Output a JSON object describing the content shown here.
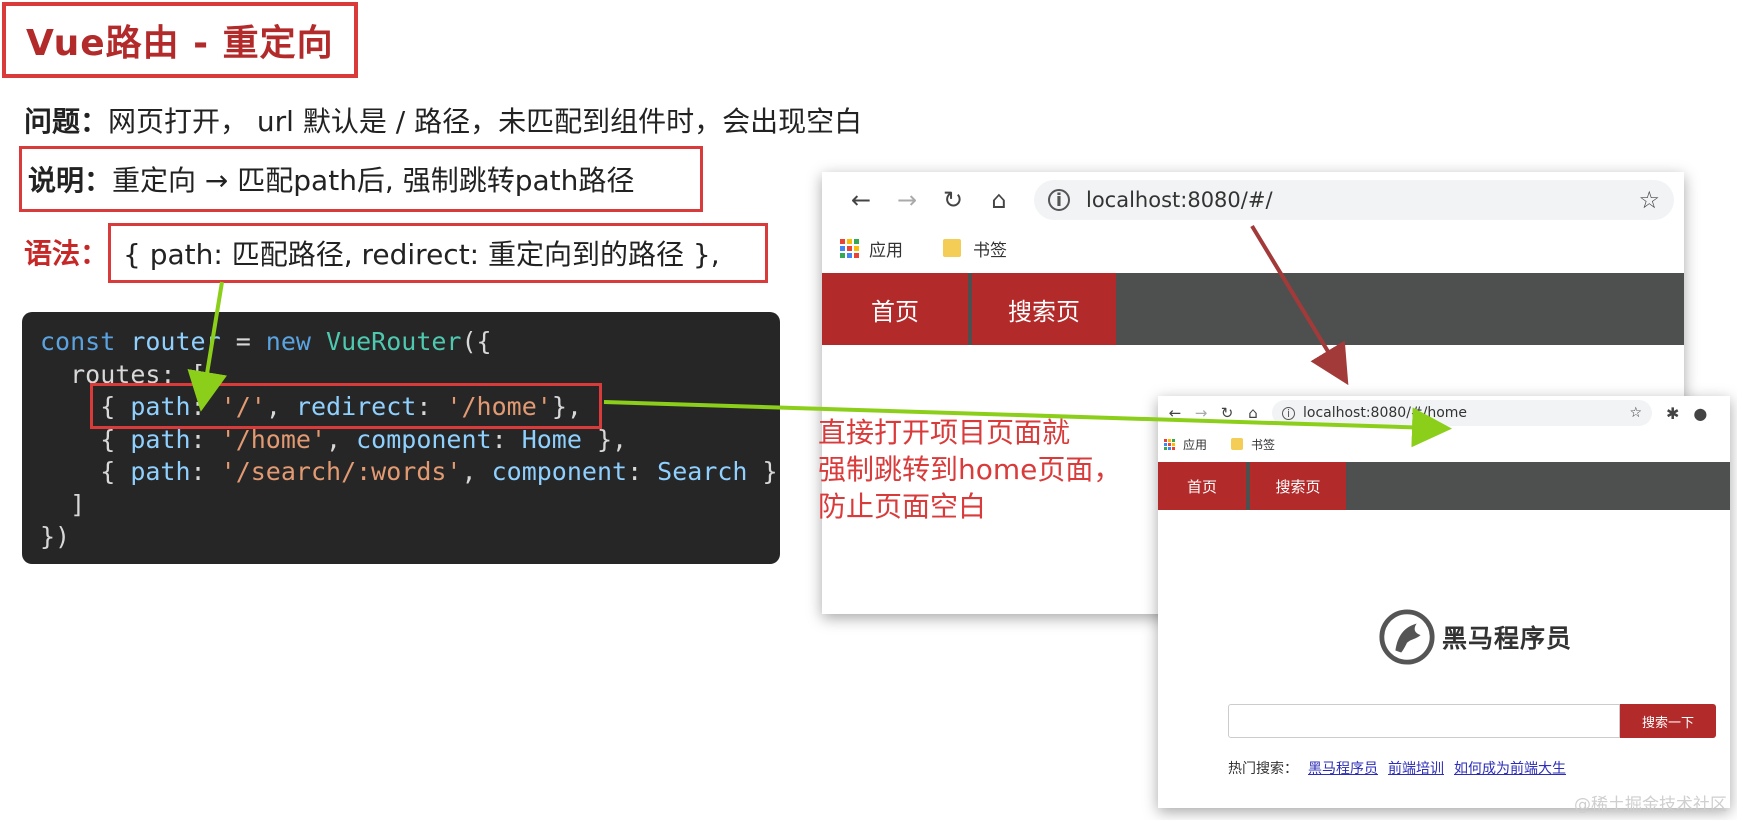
{
  "slide": {
    "title": "Vue路由 - 重定向",
    "question_label": "问题：",
    "question_text": "网页打开， url 默认是 / 路径，未匹配到组件时，会出现空白",
    "explain_label": "说明：",
    "explain_text": "重定向 → 匹配path后, 强制跳转path路径",
    "syntax_label": "语法：",
    "syntax_text": "{ path: 匹配路径, redirect: 重定向到的路径 },",
    "annotation_lines": [
      "直接打开项目页面就",
      "强制跳转到home页面，",
      "防止页面空白"
    ],
    "watermark": "@稀土掘金技术社区"
  },
  "code": {
    "l1_const": "const",
    "l1_router": "router",
    "l1_eq": " = ",
    "l1_new": "new",
    "l1_cls": "VueRouter",
    "l1_end": "({",
    "l2_routes": "routes",
    "l2_end": ": [",
    "r1_open": "{ ",
    "r1_path": "path",
    "r1_colon": ": ",
    "r1_val": "'/'",
    "r1_comma": ", ",
    "r1_redirect": "redirect",
    "r1_colon2": ": ",
    "r1_val2": "'/home'",
    "r1_close": "},",
    "r2_open": "{ ",
    "r2_path": "path",
    "r2_colon": ": ",
    "r2_val": "'/home'",
    "r2_comma": ", ",
    "r2_comp": "component",
    "r2_colon2": ": ",
    "r2_val2": "Home",
    "r2_close": " },",
    "r3_open": "{ ",
    "r3_path": "path",
    "r3_colon": ": ",
    "r3_val": "'/search/:words'",
    "r3_comma": ", ",
    "r3_comp": "component",
    "r3_colon2": ": ",
    "r3_val2": "Search",
    "r3_close": " }",
    "l_arr_close": "]",
    "l_end": "})"
  },
  "browser1": {
    "url": "localhost:8080/#/",
    "bookmarks": [
      "应用",
      "书签"
    ],
    "nav_items": [
      "首页",
      "搜索页"
    ]
  },
  "browser2": {
    "url": "localhost:8080/#/home",
    "bookmarks": [
      "应用",
      "书签"
    ],
    "nav_items": [
      "首页",
      "搜索页"
    ],
    "logo_text": "黑马程序员",
    "search_button": "搜索一下",
    "search_value": "",
    "hot_label": "热门搜索：",
    "hot_links": [
      "黑马程序员",
      "前端培训",
      "如何成为前端大生"
    ]
  },
  "icons": {
    "back": "arrow-left-icon",
    "forward": "arrow-right-icon",
    "reload": "reload-icon",
    "home": "home-icon",
    "info": "info-icon",
    "star": "star-icon",
    "extensions": "puzzle-icon",
    "profile": "profile-icon"
  },
  "colors": {
    "accent_red": "#d93a3a",
    "nav_red": "#b22a2a",
    "nav_gray": "#4d504e",
    "arrow_green": "#8ccf1a",
    "arrow_darkred": "#a33a3a",
    "code_bg": "#262626"
  }
}
